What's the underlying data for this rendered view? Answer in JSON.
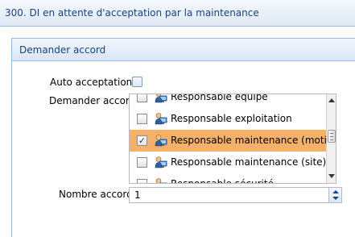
{
  "window": {
    "title": "300. DI en attente d'acceptation par la maintenance"
  },
  "panel": {
    "title": "Demander accord"
  },
  "form": {
    "auto_acceptation_label": "Auto acceptation",
    "auto_acceptation_checked": false,
    "demander_accord_label": "Demander accord",
    "nombre_accord_label": "Nombre accord",
    "nombre_accord_value": "1"
  },
  "accord_list": {
    "items": [
      {
        "label": "Responsable équipe",
        "checked": false,
        "selected": false,
        "icon": "user-computer-icon"
      },
      {
        "label": "Responsable exploitation",
        "checked": false,
        "selected": false,
        "icon": "user-computer-icon"
      },
      {
        "label": "Responsable maintenance (motif)",
        "checked": true,
        "selected": true,
        "icon": "user-computer-icon"
      },
      {
        "label": "Responsable maintenance (site)",
        "checked": false,
        "selected": false,
        "icon": "user-computer-icon"
      },
      {
        "label": "Responsable sécurité",
        "checked": false,
        "selected": false,
        "icon": "user-computer-icon"
      }
    ]
  },
  "colors": {
    "header_text": "#15428b",
    "border": "#99bbe8",
    "selection": "#f6b168"
  }
}
